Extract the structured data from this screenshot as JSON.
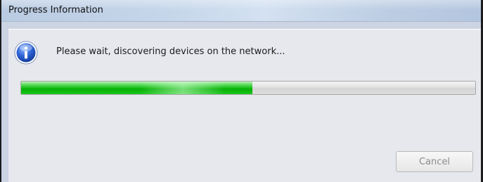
{
  "window": {
    "title": "Progress Information"
  },
  "dialog": {
    "icon": "info-icon",
    "message": "Please wait, discovering devices on the network...",
    "progress_fraction": 0.51
  },
  "buttons": {
    "cancel_label": "Cancel",
    "cancel_enabled": false
  },
  "colors": {
    "progress_fill": "#07b007",
    "titlebar": "#c6d6ea",
    "client_background": "#e7e8ee"
  }
}
